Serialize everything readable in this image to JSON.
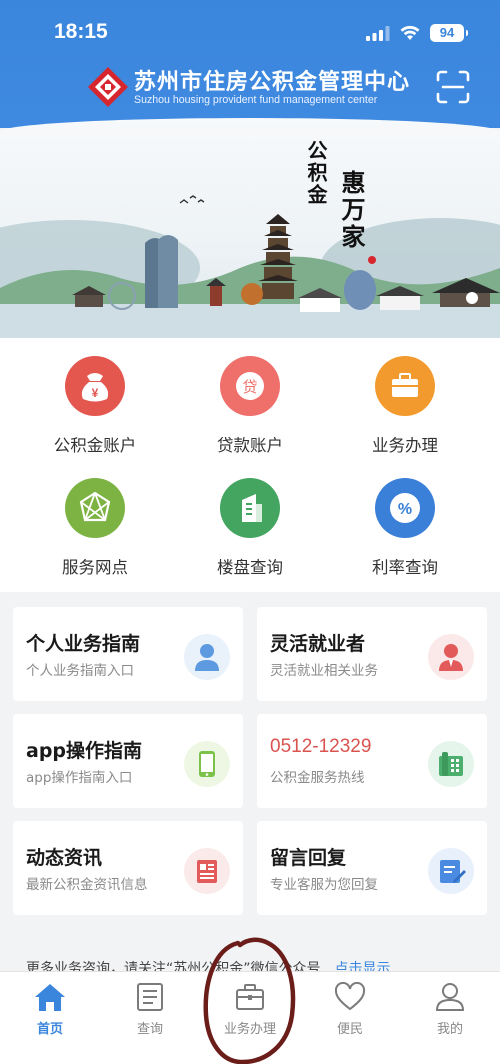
{
  "status": {
    "time": "18:15",
    "battery": "94"
  },
  "header": {
    "org_name": "苏州市住房公积金管理中心",
    "org_name_en": "Suzhou housing provident fund management center"
  },
  "banner": {
    "slogan_line1": "公积金",
    "slogan_line2": "惠万家"
  },
  "quick_menu": [
    {
      "label": "公积金账户",
      "icon": "money-bag-icon",
      "color": "#e4574f"
    },
    {
      "label": "贷款账户",
      "icon": "loan-icon",
      "color": "#ef6f6a"
    },
    {
      "label": "业务办理",
      "icon": "briefcase-icon",
      "color": "#f39a2e"
    },
    {
      "label": "服务网点",
      "icon": "network-icon",
      "color": "#7cb342"
    },
    {
      "label": "楼盘查询",
      "icon": "building-icon",
      "color": "#43a560"
    },
    {
      "label": "利率查询",
      "icon": "percent-icon",
      "color": "#3a7fd8"
    }
  ],
  "cards": [
    {
      "title": "个人业务指南",
      "subtitle": "个人业务指南入口",
      "icon": "person-icon"
    },
    {
      "title": "灵活就业者",
      "subtitle": "灵活就业相关业务",
      "icon": "worker-icon"
    },
    {
      "title": "app操作指南",
      "subtitle": "app操作指南入口",
      "icon": "phone-icon"
    },
    {
      "title": "0512-12329",
      "subtitle": "公积金服务热线",
      "icon": "telephone-icon"
    },
    {
      "title": "动态资讯",
      "subtitle": "最新公积金资讯信息",
      "icon": "news-icon"
    },
    {
      "title": "留言回复",
      "subtitle": "专业客服为您回复",
      "icon": "message-icon"
    }
  ],
  "notice": {
    "text": "更多业务咨询，请关注“苏州公积金”微信公众号",
    "link": "点击显示"
  },
  "tabs": [
    {
      "label": "首页",
      "icon": "home-icon"
    },
    {
      "label": "查询",
      "icon": "query-icon"
    },
    {
      "label": "业务办理",
      "icon": "briefcase-icon"
    },
    {
      "label": "便民",
      "icon": "heart-icon"
    },
    {
      "label": "我的",
      "icon": "user-icon"
    }
  ],
  "colors": {
    "brand": "#3b86dd",
    "phone": "#d9534f",
    "background": "#f2f3f5"
  }
}
